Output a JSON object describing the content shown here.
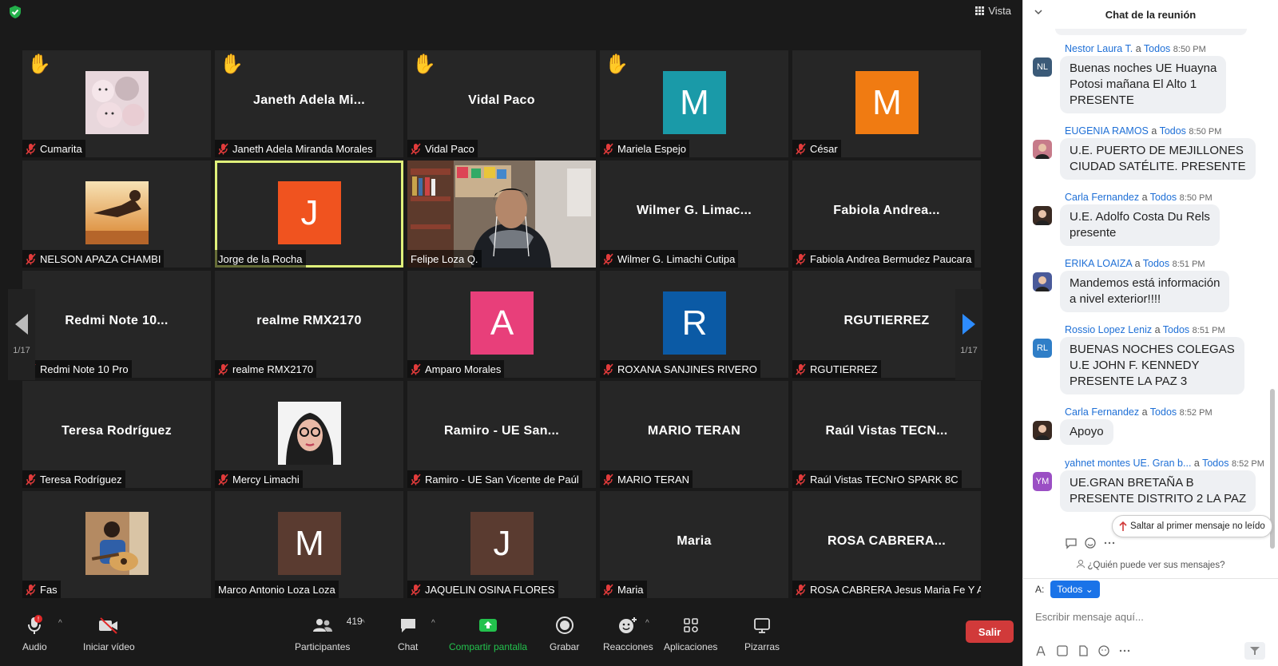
{
  "topbar": {
    "view_label": "Vista"
  },
  "tiles": [
    {
      "name": "Cumarita",
      "hand": true,
      "kind": "photo",
      "photo": "plush"
    },
    {
      "name": "Janeth Adela Miranda Morales",
      "center": "Janeth Adela Mi...",
      "hand": true,
      "kind": "name"
    },
    {
      "name": "Vidal Paco",
      "center": "Vidal Paco",
      "hand": true,
      "kind": "name"
    },
    {
      "name": "Mariela Espejo",
      "hand": true,
      "kind": "avatar",
      "letter": "M",
      "color": "#1a9aa8"
    },
    {
      "name": "César",
      "kind": "avatar",
      "letter": "M",
      "color": "#f07b12"
    },
    {
      "name": "NELSON  APAZA CHAMBI",
      "kind": "photo",
      "photo": "sunset"
    },
    {
      "name": "Jorge de la Rocha",
      "kind": "avatar",
      "letter": "J",
      "color": "#f0531f",
      "active": true,
      "unmuted": true
    },
    {
      "name": "Felipe Loza Q.",
      "kind": "video",
      "unmuted": true
    },
    {
      "name": "Wilmer G. Limachi Cutipa",
      "center": "Wilmer G. Limac...",
      "kind": "name"
    },
    {
      "name": "Fabiola Andrea Bermudez Paucara",
      "center": "Fabiola Andrea...",
      "kind": "name"
    },
    {
      "name": "Redmi Note 10 Pro",
      "center": "Redmi Note 10...",
      "kind": "name"
    },
    {
      "name": "realme RMX2170",
      "center": "realme RMX2170",
      "kind": "name"
    },
    {
      "name": "Amparo Morales",
      "kind": "avatar",
      "letter": "A",
      "color": "#e83f7a"
    },
    {
      "name": "ROXANA SANJINES RIVERO",
      "kind": "avatar",
      "letter": "R",
      "color": "#0b5aa5"
    },
    {
      "name": "RGUTIERREZ",
      "center": "RGUTIERREZ",
      "kind": "name"
    },
    {
      "name": "Teresa Rodríguez",
      "center": "Teresa Rodríguez",
      "kind": "name"
    },
    {
      "name": "Mercy Limachi",
      "kind": "photo",
      "photo": "portrait"
    },
    {
      "name": "Ramiro - UE San Vicente de Paúl",
      "center": "Ramiro - UE San...",
      "kind": "name"
    },
    {
      "name": "MARIO TERAN",
      "center": "MARIO TERAN",
      "kind": "name"
    },
    {
      "name": "Raúl Vistas TECNrO SPARK 8C",
      "center": "Raúl Vistas TECN...",
      "kind": "name"
    },
    {
      "name": "Fas",
      "kind": "photo",
      "photo": "guitar"
    },
    {
      "name": "Marco Antonio Loza Loza",
      "kind": "avatar",
      "letter": "M",
      "color": "#5a3b30",
      "unmuted": true
    },
    {
      "name": "JAQUELIN OSINA FLORES",
      "kind": "avatar",
      "letter": "J",
      "color": "#5a3b30"
    },
    {
      "name": "Maria",
      "center": "Maria",
      "kind": "name"
    },
    {
      "name": "ROSA CABRERA Jesus Maria Fe Y A...",
      "center": "ROSA  CABRERA...",
      "kind": "name"
    }
  ],
  "pager": {
    "left_page": "1/17",
    "right_page": "1/17"
  },
  "toolbar": {
    "audio": "Audio",
    "video": "Iniciar vídeo",
    "participants": "Participantes",
    "participants_count": "419",
    "chat": "Chat",
    "share": "Compartir pantalla",
    "record": "Grabar",
    "reactions": "Reacciones",
    "apps": "Aplicaciones",
    "whiteboards": "Pizarras",
    "leave": "Salir"
  },
  "chat": {
    "title": "Chat de la reunión",
    "messages": [
      {
        "sender": "Nestor Laura T.",
        "to": "a",
        "target": "Todos",
        "time": "8:50 PM",
        "text": "Buenas noches UE Huayna\nPotosi mañana El Alto 1\nPRESENTE",
        "initials": "NL",
        "avatar_color": "#3b5a78"
      },
      {
        "sender": "EUGENIA RAMOS",
        "to": "a",
        "target": "Todos",
        "time": "8:50 PM",
        "text": "U.E. PUERTO DE MEJILLONES\nCIUDAD SATÉLITE. PRESENTE",
        "initials": "",
        "avatar_color": "#c77b8a"
      },
      {
        "sender": "Carla Fernandez",
        "to": "a",
        "target": "Todos",
        "time": "8:50 PM",
        "text": "U.E. Adolfo Costa Du Rels\npresente",
        "initials": "",
        "avatar_color": "#3a2a22"
      },
      {
        "sender": "ERIKA LOAIZA",
        "to": "a",
        "target": "Todos",
        "time": "8:51 PM",
        "text": "Mandemos está información\na nivel exterior!!!!",
        "initials": "",
        "avatar_color": "#4a5a9a"
      },
      {
        "sender": "Rossio Lopez  Leniz",
        "to": "a",
        "target": "Todos",
        "time": "8:51 PM",
        "text": "BUENAS NOCHES COLEGAS\nU.E JOHN F. KENNEDY\nPRESENTE LA PAZ 3",
        "initials": "RL",
        "avatar_color": "#2f7ec7"
      },
      {
        "sender": "Carla Fernandez",
        "to": "a",
        "target": "Todos",
        "time": "8:52 PM",
        "text": "Apoyo",
        "initials": "",
        "avatar_color": "#3a2a22"
      },
      {
        "sender": "yahnet montes UE. Gran b...",
        "to": "a",
        "target": "Todos",
        "time": "8:52 PM",
        "text": "UE.GRAN BRETAÑA B\nPRESENTE DISTRITO 2 LA PAZ",
        "initials": "YM",
        "avatar_color": "#9b4fc4"
      }
    ],
    "jump_label": "Saltar al primer mensaje no leído",
    "who_sees": "¿Quién puede ver sus mensajes?",
    "to_label": "A:",
    "to_value": "Todos",
    "input_placeholder": "Escribir mensaje aquí..."
  }
}
